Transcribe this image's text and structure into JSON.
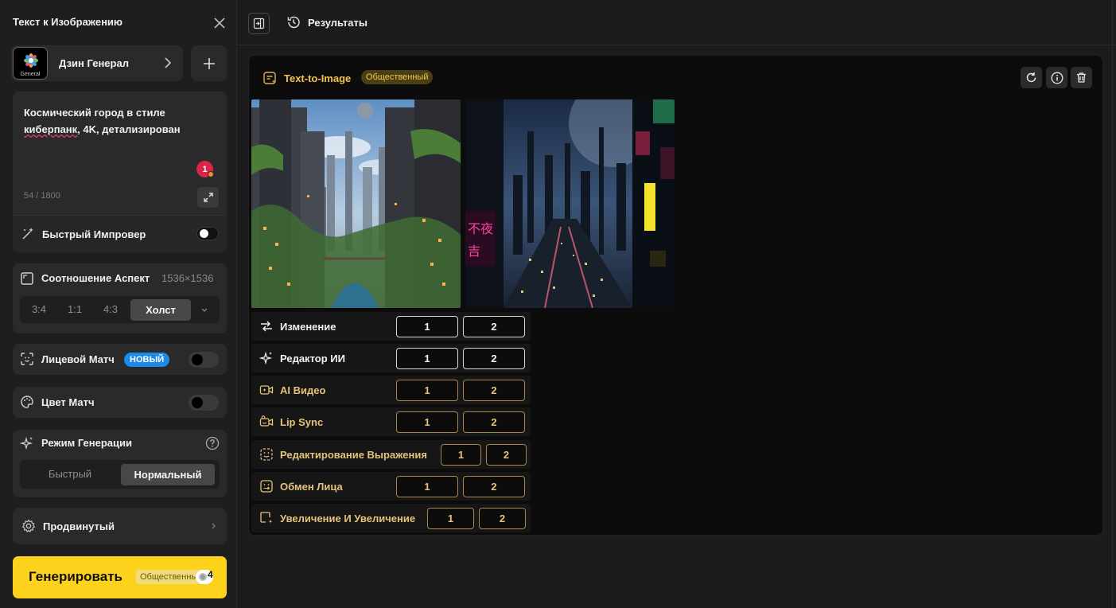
{
  "sidebar": {
    "title": "Текст к Изображению",
    "model": {
      "name": "Дзин Генерал",
      "avatar_label": "General"
    },
    "prompt": {
      "line1": "Космический город в стиле",
      "word_flagged": "киберпанк",
      "line2_rest": ", 4K, детализирован",
      "char_count": "54 / 1800",
      "notification_count": "1"
    },
    "improver": {
      "label": "Быстрый Импровер"
    },
    "aspect": {
      "label": "Соотношение Аспект",
      "size": "1536×1536",
      "options": [
        "3:4",
        "1:1",
        "4:3",
        "Холст"
      ],
      "selected": "Холст"
    },
    "face_match": {
      "label": "Лицевой Матч",
      "badge": "НОВЫЙ"
    },
    "color_match": {
      "label": "Цвет Матч"
    },
    "gen_mode": {
      "label": "Режим Генерации",
      "options": [
        "Быстрый",
        "Нормальный"
      ],
      "selected": "Нормальный"
    },
    "advanced": {
      "label": "Продвинутый"
    },
    "generate": {
      "label": "Генерировать",
      "tag": "Общественный",
      "count": "4"
    }
  },
  "topbar": {
    "results_label": "Результаты"
  },
  "result": {
    "title": "Text-to-Image",
    "badge": "Общественный",
    "actions": [
      {
        "label": "Изменение",
        "icon": "arrow-right-icon",
        "tone": "white"
      },
      {
        "label": "Редактор ИИ",
        "icon": "sparkle-icon",
        "tone": "white"
      },
      {
        "label": "AI Видео",
        "icon": "video-icon",
        "tone": "gold"
      },
      {
        "label": "Lip Sync",
        "icon": "lipsync-icon",
        "tone": "gold"
      },
      {
        "label": "Редактирование Выражения",
        "icon": "face-edit-icon",
        "tone": "gold"
      },
      {
        "label": "Обмен Лица",
        "icon": "face-swap-icon",
        "tone": "gold"
      },
      {
        "label": "Увеличение И Увеличение",
        "icon": "upscale-icon",
        "tone": "gold"
      }
    ],
    "buttons": [
      "1",
      "2"
    ]
  },
  "colors": {
    "accent": "#fcd21c",
    "gold": "#e6c27a",
    "new_badge": "#1e8ae8",
    "alert": "#d9254a"
  }
}
